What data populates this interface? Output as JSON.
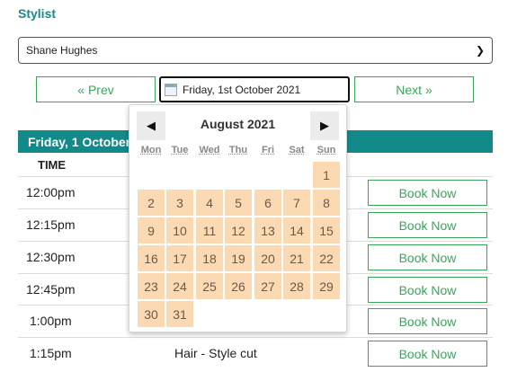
{
  "stylist": {
    "label": "Stylist",
    "selected": "Shane Hughes"
  },
  "nav": {
    "prev_label": "« Prev",
    "next_label": "Next »",
    "date_value": "Friday, 1st October 2021"
  },
  "schedule": {
    "day_title": "Friday, 1 October",
    "time_col": "TIME",
    "rows": [
      {
        "time": "12:00pm",
        "service": "",
        "book": "Book Now"
      },
      {
        "time": "12:15pm",
        "service": "",
        "book": "Book Now"
      },
      {
        "time": "12:30pm",
        "service": "",
        "book": "Book Now"
      },
      {
        "time": "12:45pm",
        "service": "",
        "book": "Book Now"
      },
      {
        "time": "1:00pm",
        "service": "",
        "book": "Book Now"
      },
      {
        "time": "1:15pm",
        "service": "Hair - Style cut",
        "book": "Book Now"
      }
    ]
  },
  "datepicker": {
    "title": "August 2021",
    "dow": [
      "Mon",
      "Tue",
      "Wed",
      "Thu",
      "Fri",
      "Sat",
      "Sun"
    ],
    "days": [
      "1",
      "2",
      "3",
      "4",
      "5",
      "6",
      "7",
      "8",
      "9",
      "10",
      "11",
      "12",
      "13",
      "14",
      "15",
      "16",
      "17",
      "18",
      "19",
      "20",
      "21",
      "22",
      "23",
      "24",
      "25",
      "26",
      "27",
      "28",
      "29",
      "30",
      "31"
    ],
    "day_bg": "#fbd9b3",
    "accent": "#138a8a",
    "button_color": "#3aa65a"
  }
}
